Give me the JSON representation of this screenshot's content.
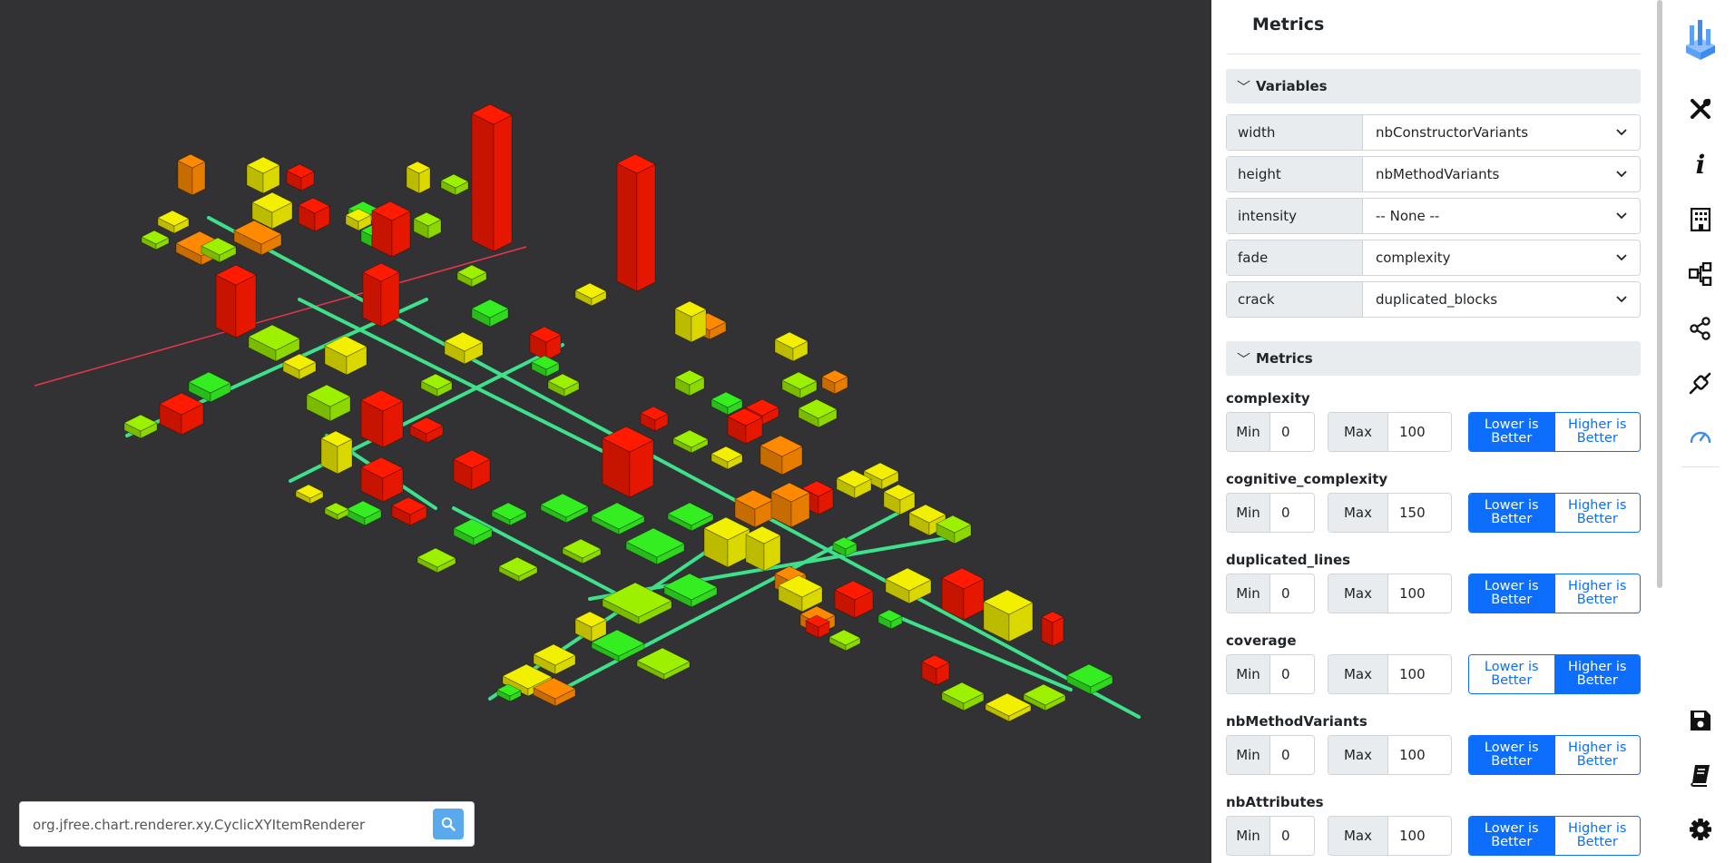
{
  "search": {
    "value": "org.jfree.chart.renderer.xy.CyclicXYItemRenderer"
  },
  "panel": {
    "title": "Metrics",
    "variables_header": "Variables",
    "variables": [
      {
        "label": "width",
        "value": "nbConstructorVariants"
      },
      {
        "label": "height",
        "value": "nbMethodVariants"
      },
      {
        "label": "intensity",
        "value": "-- None --"
      },
      {
        "label": "fade",
        "value": "complexity"
      },
      {
        "label": "crack",
        "value": "duplicated_blocks"
      }
    ],
    "metrics_header": "Metrics",
    "min_label": "Min",
    "max_label": "Max",
    "lower_label": "Lower is Better",
    "higher_label": "Higher is Better",
    "metrics": [
      {
        "name": "complexity",
        "min": "0",
        "max": "100",
        "better": "lower"
      },
      {
        "name": "cognitive_complexity",
        "min": "0",
        "max": "150",
        "better": "lower"
      },
      {
        "name": "duplicated_lines",
        "min": "0",
        "max": "100",
        "better": "lower"
      },
      {
        "name": "coverage",
        "min": "0",
        "max": "100",
        "better": "higher"
      },
      {
        "name": "nbMethodVariants",
        "min": "0",
        "max": "100",
        "better": "lower"
      },
      {
        "name": "nbAttributes",
        "min": "0",
        "max": "100",
        "better": "lower"
      }
    ]
  },
  "rail": {
    "top_icons": [
      "logo-icon",
      "tools-icon",
      "info-icon",
      "building-icon",
      "hierarchy-icon",
      "share-icon",
      "plugin-icon",
      "gauge-icon"
    ],
    "bottom_icons": [
      "save-icon",
      "book-icon",
      "gear-icon"
    ],
    "active": "gauge-icon"
  },
  "colors": {
    "viewport_bg": "#323235",
    "accent": "#0d6efd",
    "red": "#ff1a00",
    "orange": "#ff8a00",
    "yellow": "#f2f000",
    "lime": "#9cf000",
    "green": "#35ee22",
    "road": "#3ee08a"
  }
}
